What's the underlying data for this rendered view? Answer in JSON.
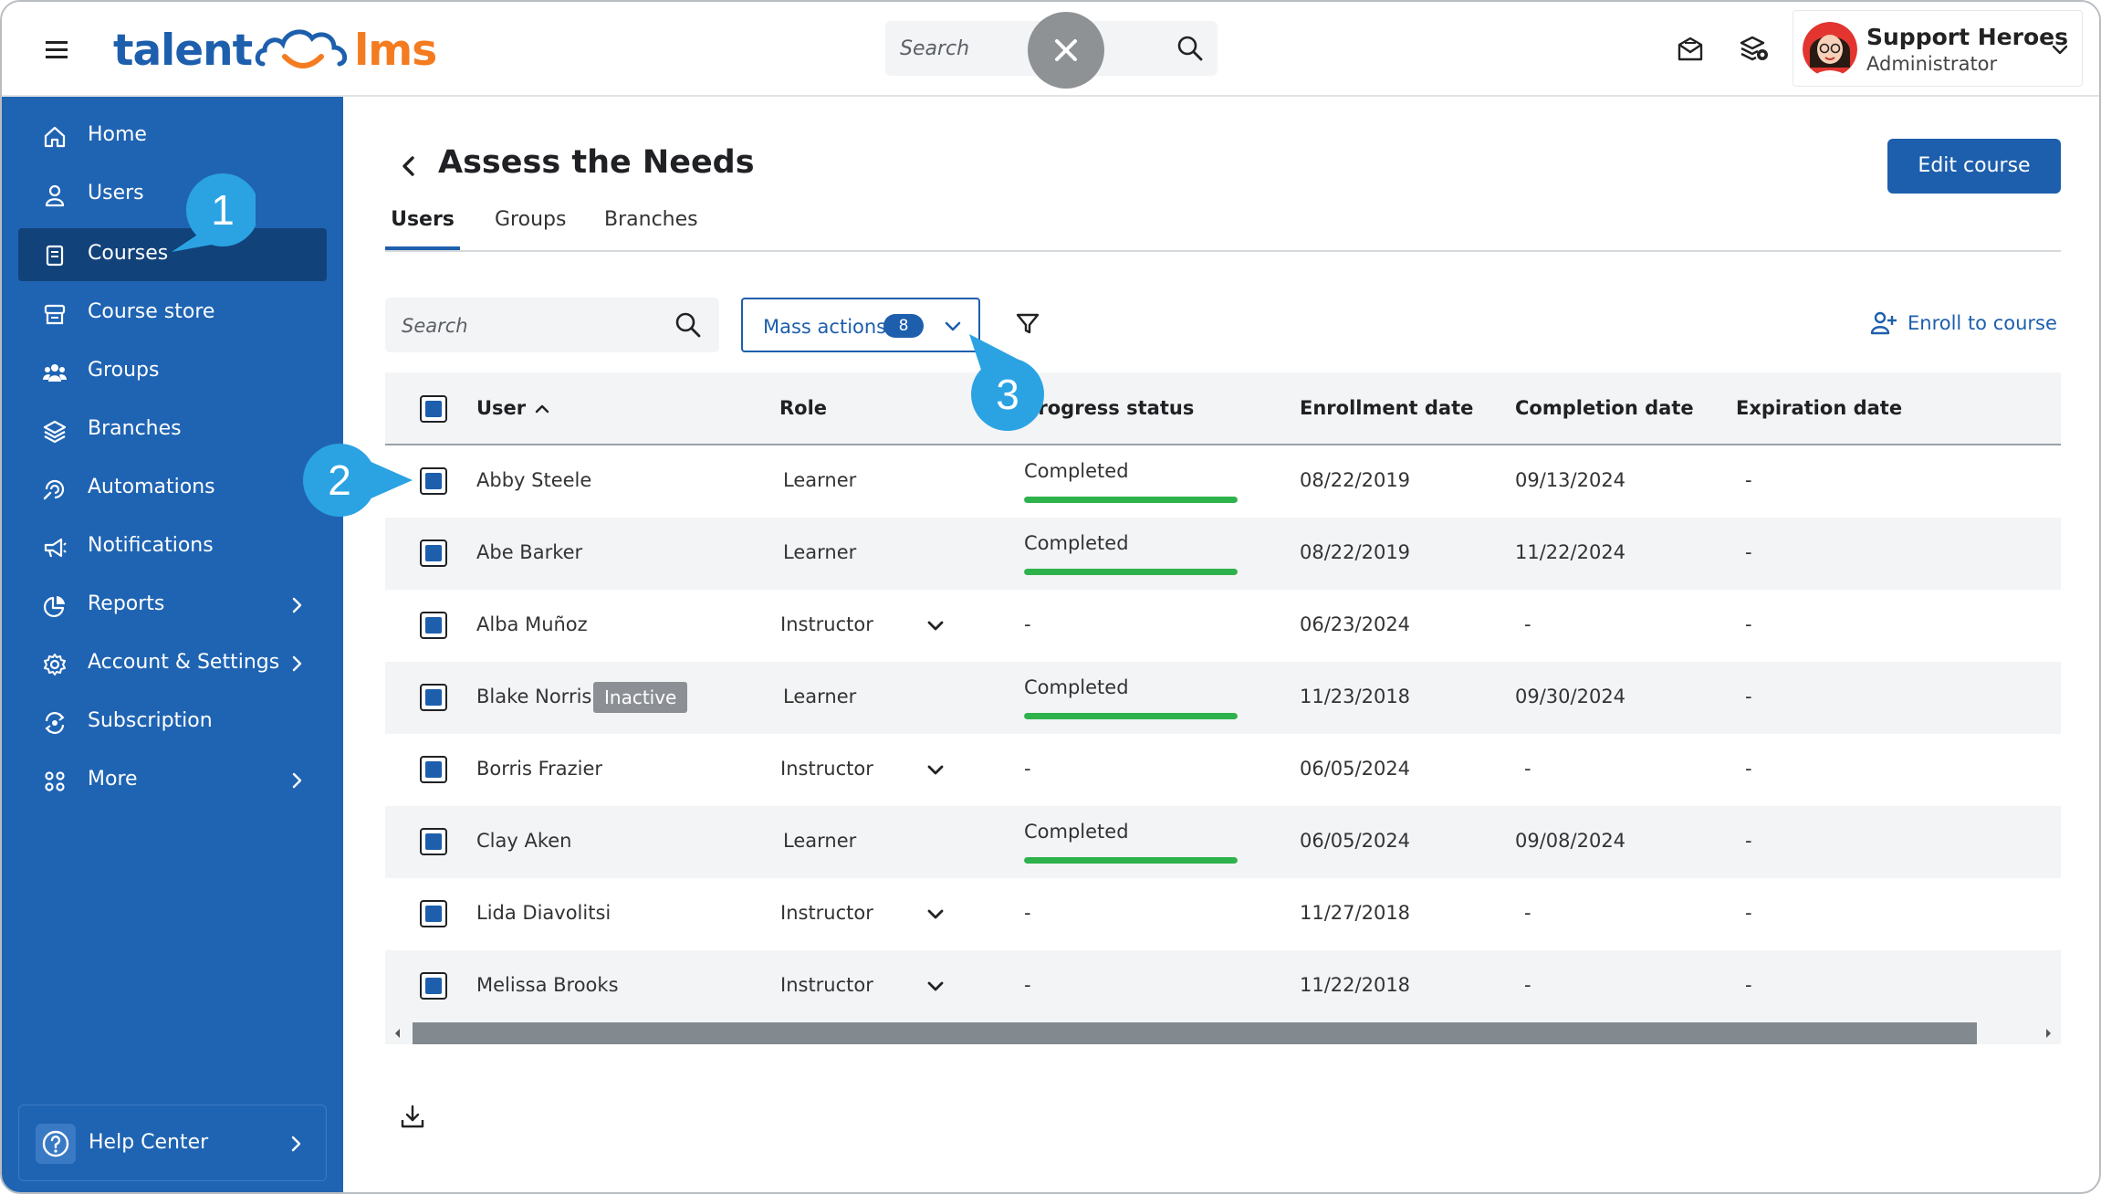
{
  "header": {
    "logo_left": "talent",
    "logo_right": "lms",
    "search_placeholder": "Search",
    "user_name": "Support Heroes",
    "user_role": "Administrator"
  },
  "sidebar": {
    "items": [
      {
        "label": "Home",
        "icon": "home-icon"
      },
      {
        "label": "Users",
        "icon": "user-icon"
      },
      {
        "label": "Courses",
        "icon": "book-icon",
        "active": true
      },
      {
        "label": "Course store",
        "icon": "store-icon"
      },
      {
        "label": "Groups",
        "icon": "groups-icon"
      },
      {
        "label": "Branches",
        "icon": "layers-icon"
      },
      {
        "label": "Automations",
        "icon": "automation-icon"
      },
      {
        "label": "Notifications",
        "icon": "megaphone-icon"
      },
      {
        "label": "Reports",
        "icon": "pie-chart-icon",
        "has_submenu": true
      },
      {
        "label": "Account & Settings",
        "icon": "gear-icon",
        "has_submenu": true
      },
      {
        "label": "Subscription",
        "icon": "subscription-icon"
      },
      {
        "label": "More",
        "icon": "grid-icon",
        "has_submenu": true
      }
    ],
    "help_label": "Help Center"
  },
  "page": {
    "title": "Assess the Needs",
    "edit_button": "Edit course",
    "tabs": [
      "Users",
      "Groups",
      "Branches"
    ],
    "active_tab": "Users",
    "search_placeholder": "Search",
    "mass_actions_label": "Mass actions",
    "mass_actions_count": "8",
    "enroll_label": "Enroll to course"
  },
  "table": {
    "columns": [
      "User",
      "Role",
      "Progress status",
      "Enrollment date",
      "Completion date",
      "Expiration date"
    ],
    "sorted_by": "User",
    "rows": [
      {
        "user": "Abby Steele",
        "role": "Learner",
        "progress": "Completed",
        "progress_fraction": 1.0,
        "enrollment": "08/22/2019",
        "completion": "09/13/2024",
        "expiration": "-"
      },
      {
        "user": "Abe Barker",
        "role": "Learner",
        "progress": "Completed",
        "progress_fraction": 1.0,
        "enrollment": "08/22/2019",
        "completion": "11/22/2024",
        "expiration": "-"
      },
      {
        "user": "Alba Muñoz",
        "role": "Instructor",
        "progress": "-",
        "enrollment": "06/23/2024",
        "completion": "-",
        "expiration": "-"
      },
      {
        "user": "Blake Norris",
        "badge": "Inactive",
        "role": "Learner",
        "progress": "Completed",
        "progress_fraction": 1.0,
        "enrollment": "11/23/2018",
        "completion": "09/30/2024",
        "expiration": "-"
      },
      {
        "user": "Borris Frazier",
        "role": "Instructor",
        "progress": "-",
        "enrollment": "06/05/2024",
        "completion": "-",
        "expiration": "-"
      },
      {
        "user": "Clay Aken",
        "role": "Learner",
        "progress": "Completed",
        "progress_fraction": 1.0,
        "enrollment": "06/05/2024",
        "completion": "09/08/2024",
        "expiration": "-"
      },
      {
        "user": "Lida Diavolitsi",
        "role": "Instructor",
        "progress": "-",
        "enrollment": "11/27/2018",
        "completion": "-",
        "expiration": "-"
      },
      {
        "user": "Melissa Brooks",
        "role": "Instructor",
        "progress": "-",
        "enrollment": "11/22/2018",
        "completion": "-",
        "expiration": "-"
      }
    ]
  },
  "callouts": [
    "1",
    "2",
    "3"
  ],
  "colors": {
    "brand_blue": "#1d5fad",
    "sidebar_blue": "#1f64b3",
    "sidebar_active": "#11427a",
    "callout_blue": "#2ba3e3",
    "logo_orange": "#f47b20",
    "progress_green": "#2eb24b"
  }
}
